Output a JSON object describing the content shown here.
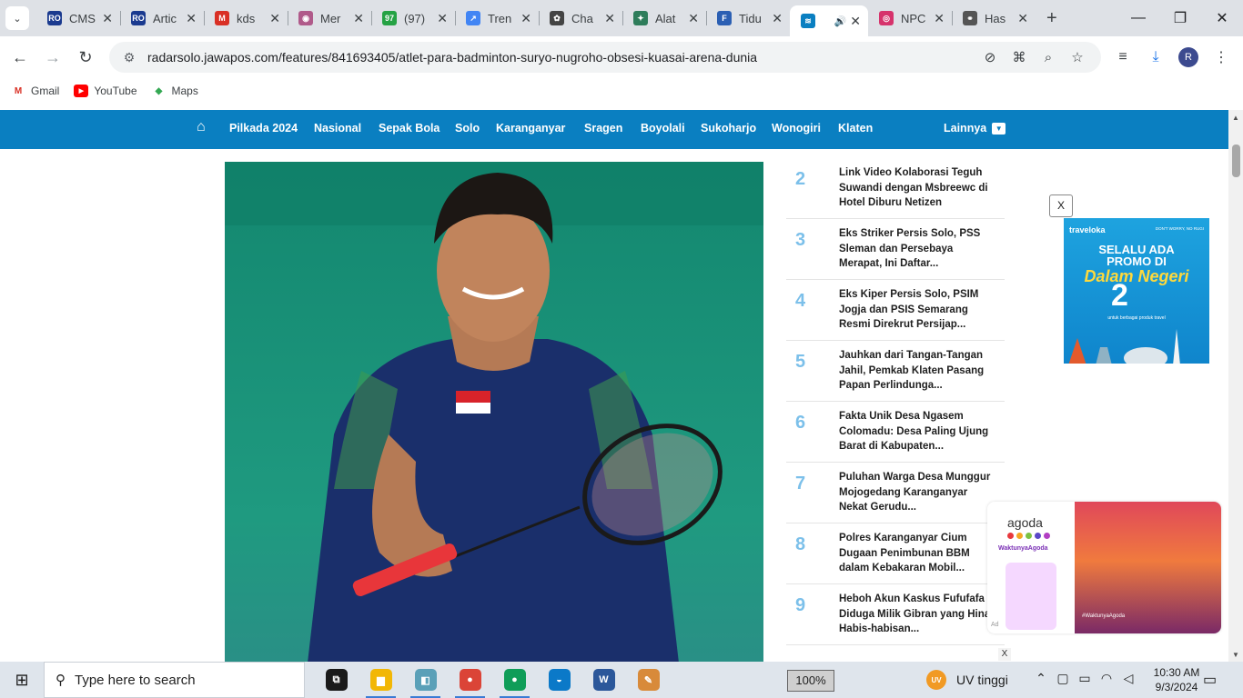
{
  "browser": {
    "tabs": [
      {
        "label": "CMS",
        "icon": "ro-icon",
        "fav": "RO",
        "color": "#1a3a8f"
      },
      {
        "label": "Artic",
        "icon": "ro-icon",
        "fav": "RO",
        "color": "#1a3a8f"
      },
      {
        "label": "kds",
        "icon": "gmail-icon",
        "fav": "M",
        "color": "#d93025"
      },
      {
        "label": "Mer",
        "icon": "globe-icon",
        "fav": "◉",
        "color": "#b05a8a"
      },
      {
        "label": "(97)",
        "icon": "whatsapp-icon",
        "fav": "97",
        "color": "#25a244"
      },
      {
        "label": "Tren",
        "icon": "trends-icon",
        "fav": "↗",
        "color": "#4285f4"
      },
      {
        "label": "Cha",
        "icon": "chatgpt-icon",
        "fav": "✿",
        "color": "#444444"
      },
      {
        "label": "Alat",
        "icon": "app-icon",
        "fav": "✦",
        "color": "#2e7d5b"
      },
      {
        "label": "Tidu",
        "icon": "doc-icon",
        "fav": "F",
        "color": "#2b5fb3"
      },
      {
        "label": "",
        "icon": "radar-icon",
        "fav": "≋",
        "color": "#0a7fc1",
        "active": true
      },
      {
        "label": "NPC",
        "icon": "instagram-icon",
        "fav": "◎",
        "color": "#d6336c"
      },
      {
        "label": "Has",
        "icon": "link-icon",
        "fav": "⚭",
        "color": "#555555"
      }
    ],
    "url": "radarsolo.jawapos.com/features/841693405/atlet-para-badminton-suryo-nugroho-obsesi-kuasai-arena-dunia",
    "bookmarks": [
      {
        "label": "Gmail",
        "icon": "gmail-icon"
      },
      {
        "label": "YouTube",
        "icon": "youtube-icon"
      },
      {
        "label": "Maps",
        "icon": "maps-icon"
      }
    ],
    "profile_initial": "R"
  },
  "site": {
    "nav": [
      "Pilkada 2024",
      "Nasional",
      "Sepak Bola",
      "Solo",
      "Karanganyar",
      "Sragen",
      "Boyolali",
      "Sukoharjo",
      "Wonogiri",
      "Klaten"
    ],
    "nav_more": "Lainnya",
    "accent": "#0a7fc1",
    "ranking": [
      {
        "num": "2",
        "title": "Link Video Kolaborasi Teguh Suwandi dengan Msbreewc di Hotel Diburu Netizen"
      },
      {
        "num": "3",
        "title": "Eks Striker Persis Solo, PSS Sleman dan Persebaya Merapat, Ini Daftar..."
      },
      {
        "num": "4",
        "title": "Eks Kiper Persis Solo, PSIM Jogja dan PSIS Semarang Resmi Direkrut Persijap..."
      },
      {
        "num": "5",
        "title": "Jauhkan dari Tangan-Tangan Jahil, Pemkab Klaten Pasang Papan Perlindunga..."
      },
      {
        "num": "6",
        "title": "Fakta Unik Desa Ngasem Colomadu: Desa Paling Ujung Barat di Kabupaten..."
      },
      {
        "num": "7",
        "title": "Puluhan Warga Desa Munggur Mojogedang Karanganyar Nekat Gerudu..."
      },
      {
        "num": "8",
        "title": "Polres Karanganyar Cium Dugaan Penimbunan BBM dalam Kebakaran Mobil..."
      },
      {
        "num": "9",
        "title": "Heboh Akun Kaskus Fufufafa Diduga Milik Gibran yang Hina Habis-habisan..."
      }
    ],
    "ad_close": "X",
    "ad2_close": "X",
    "traveloka": {
      "brand": "traveloka",
      "tag": "DON'T WORRY, NO RUGI",
      "line1": "SELALU ADA",
      "line2": "PROMO DI",
      "line3": "Dalam Negeri",
      "big": "2",
      "sub": "untuk berbagai produk travel"
    },
    "agoda": {
      "logo": "agoda",
      "slogan": "WaktunyaAgoda",
      "caption": "#WaktunyaAgoda",
      "ad_label": "Ad"
    }
  },
  "taskbar": {
    "search_placeholder": "Type here to search",
    "zoom": "100%",
    "weather": "UV tinggi",
    "weather_icon": "UV",
    "time": "10:30 AM",
    "date": "9/3/2024",
    "apps": [
      {
        "name": "task-view-icon",
        "glyph": "⧉",
        "color": "#1a1a1a"
      },
      {
        "name": "file-explorer-icon",
        "glyph": "▆",
        "color": "#f2b705"
      },
      {
        "name": "app-icon",
        "glyph": "◧",
        "color": "#5aa0b8"
      },
      {
        "name": "chrome-icon",
        "glyph": "●",
        "color": "#db4437"
      },
      {
        "name": "chrome-profile-icon",
        "glyph": "●",
        "color": "#0f9d58"
      },
      {
        "name": "edge-icon",
        "glyph": "◒",
        "color": "#0b79c8"
      },
      {
        "name": "word-icon",
        "glyph": "W",
        "color": "#2b579a"
      },
      {
        "name": "paint-icon",
        "glyph": "✎",
        "color": "#d88a3a"
      }
    ]
  }
}
